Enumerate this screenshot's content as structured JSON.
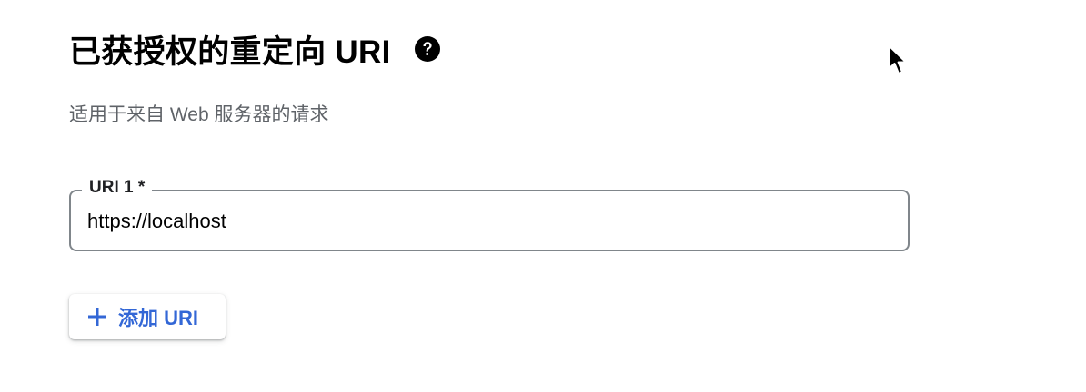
{
  "section": {
    "title": "已获授权的重定向 URI",
    "help_icon": "help-circle-icon",
    "subtitle": "适用于来自 Web 服务器的请求"
  },
  "uri_field": {
    "label": "URI 1 *",
    "value": "https://localhost"
  },
  "add_button": {
    "icon": "plus-icon",
    "label": "添加 URI",
    "color": "#3367d6"
  },
  "pointer": {
    "icon": "mouse-cursor-icon"
  }
}
